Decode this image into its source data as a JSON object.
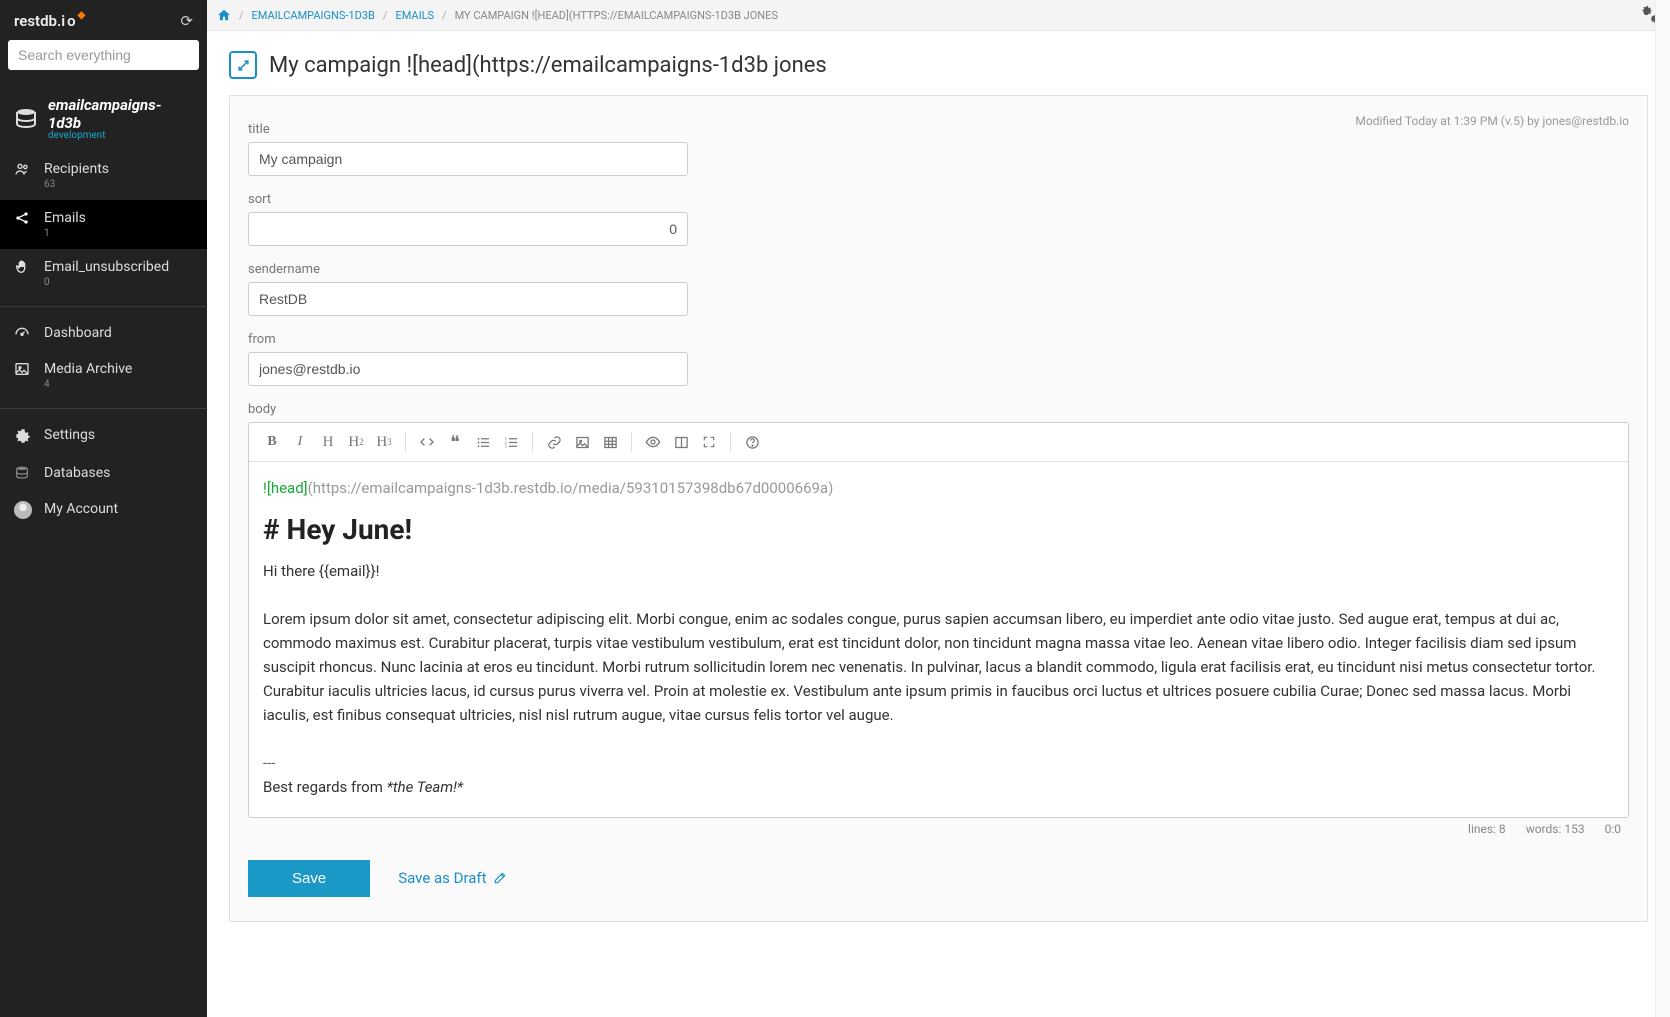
{
  "logo": {
    "text": "restdb.i",
    "suffix": "o"
  },
  "search": {
    "placeholder": "Search everything"
  },
  "db": {
    "name": "emailcampaigns-1d3b",
    "env": "development"
  },
  "nav_collections": [
    {
      "label": "Recipients",
      "count": "63"
    },
    {
      "label": "Emails",
      "count": "1"
    },
    {
      "label": "Email_unsubscribed",
      "count": "0"
    }
  ],
  "nav_tools": [
    {
      "label": "Dashboard"
    },
    {
      "label": "Media Archive",
      "count": "4"
    }
  ],
  "nav_bottom": [
    {
      "label": "Settings"
    },
    {
      "label": "Databases"
    },
    {
      "label": "My Account"
    }
  ],
  "breadcrumb": {
    "link1": "EMAILCAMPAIGNS-1D3B",
    "link2": "EMAILS",
    "current": "MY CAMPAIGN ![HEAD](HTTPS://EMAILCAMPAIGNS-1D3B JONES"
  },
  "page_title": "My campaign ![head](https://emailcampaigns-1d3b jones",
  "modified": "Modified Today at 1:39 PM (v.5) by jones@restdb.io",
  "fields": {
    "title": {
      "label": "title",
      "value": "My campaign"
    },
    "sort": {
      "label": "sort",
      "value": "0"
    },
    "sendername": {
      "label": "sendername",
      "value": "RestDB"
    },
    "from": {
      "label": "from",
      "value": "jones@restdb.io"
    },
    "body": {
      "label": "body"
    }
  },
  "editor": {
    "imgtag": "![head]",
    "imgurl": "(https://emailcampaigns-1d3b.restdb.io/media/59310157398db67d0000669a)",
    "heading": "# Hey June!",
    "greeting": "Hi there {{email}}!",
    "lorem": "Lorem ipsum dolor sit amet, consectetur adipiscing elit. Morbi congue, enim ac sodales congue, purus sapien accumsan libero, eu imperdiet ante odio vitae justo. Sed augue erat, tempus at dui ac, commodo maximus est. Curabitur placerat, turpis vitae vestibulum vestibulum, erat est tincidunt dolor, non tincidunt magna massa vitae leo. Aenean vitae libero odio. Integer facilisis diam sed ipsum suscipit rhoncus. Nunc lacinia at eros eu tincidunt. Morbi rutrum sollicitudin lorem nec venenatis. In pulvinar, lacus a blandit commodo, ligula erat facilisis erat, eu tincidunt nisi metus consectetur tortor. Curabitur iaculis ultricies lacus, id cursus purus viverra vel. Proin at molestie ex. Vestibulum ante ipsum primis in faucibus orci luctus et ultrices posuere cubilia Curae; Donec sed massa lacus. Morbi iaculis, est finibus consequat ultricies, nisl nisl rutrum augue, vitae cursus felis tortor vel augue.",
    "hr": "---",
    "signoff_pre": "Best regards from ",
    "signoff_em": "*the Team!*",
    "footer_lines": "lines: 8",
    "footer_words": "words: 153",
    "footer_pos": "0:0"
  },
  "buttons": {
    "save": "Save",
    "draft": "Save as Draft"
  }
}
